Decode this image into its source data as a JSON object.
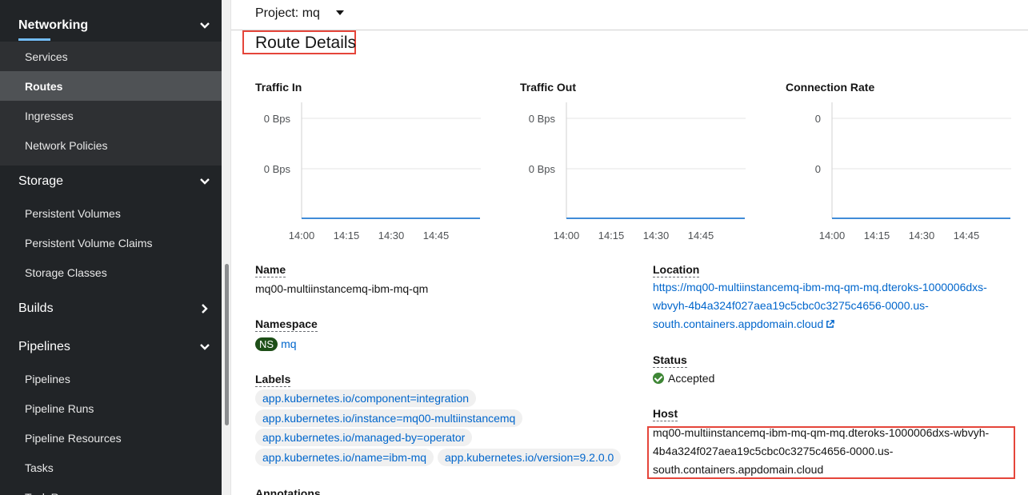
{
  "sidebar": {
    "networking": {
      "title": "Networking",
      "items": [
        "Services",
        "Routes",
        "Ingresses",
        "Network Policies"
      ]
    },
    "storage": {
      "title": "Storage",
      "items": [
        "Persistent Volumes",
        "Persistent Volume Claims",
        "Storage Classes"
      ]
    },
    "builds": {
      "title": "Builds"
    },
    "pipelines": {
      "title": "Pipelines",
      "items": [
        "Pipelines",
        "Pipeline Runs",
        "Pipeline Resources",
        "Tasks",
        "Task Runs"
      ]
    }
  },
  "header": {
    "project_label": "Project: mq"
  },
  "page": {
    "title": "Route Details"
  },
  "chart_data": [
    {
      "type": "line",
      "title": "Traffic In",
      "x": [
        "14:00",
        "14:15",
        "14:30",
        "14:45"
      ],
      "y_ticks": [
        "0 Bps",
        "0 Bps"
      ],
      "series": [
        {
          "values": [
            0,
            0,
            0,
            0
          ]
        }
      ],
      "color": "#06c"
    },
    {
      "type": "line",
      "title": "Traffic Out",
      "x": [
        "14:00",
        "14:15",
        "14:30",
        "14:45"
      ],
      "y_ticks": [
        "0 Bps",
        "0 Bps"
      ],
      "series": [
        {
          "values": [
            0,
            0,
            0,
            0
          ]
        }
      ],
      "color": "#06c"
    },
    {
      "type": "line",
      "title": "Connection Rate",
      "x": [
        "14:00",
        "14:15",
        "14:30",
        "14:45"
      ],
      "y_ticks": [
        "0",
        "0"
      ],
      "series": [
        {
          "values": [
            0,
            0,
            0,
            0
          ]
        }
      ],
      "color": "#06c"
    }
  ],
  "details": {
    "name_label": "Name",
    "name_value": "mq00-multiinstancemq-ibm-mq-qm",
    "namespace_label": "Namespace",
    "namespace_badge": "NS",
    "namespace_value": "mq",
    "labels_label": "Labels",
    "labels": [
      "app.kubernetes.io/component=integration",
      "app.kubernetes.io/instance=mq00-multiinstancemq",
      "app.kubernetes.io/managed-by=operator",
      "app.kubernetes.io/name=ibm-mq",
      "app.kubernetes.io/version=9.2.0.0"
    ],
    "annotations_label": "Annotations",
    "location_label": "Location",
    "location_lines": [
      "https://mq00-multiinstancemq-ibm-mq-qm-mq.dteroks-1000006dxs-",
      "wbvyh-4b4a324f027aea19c5cbc0c3275c4656-0000.us-",
      "south.containers.appdomain.cloud"
    ],
    "status_label": "Status",
    "status_value": "Accepted",
    "host_label": "Host",
    "host_lines": [
      "mq00-multiinstancemq-ibm-mq-qm-mq.dteroks-1000006dxs-wbvyh-",
      "4b4a324f027aea19c5cbc0c3275c4656-0000.us-",
      "south.containers.appdomain.cloud"
    ]
  },
  "colors": {
    "sidebar_bg": "#212427",
    "link": "#0066cc",
    "accent": "#73bcf7",
    "highlight_box": "#e5453a",
    "status_ok": "#3e8635"
  }
}
